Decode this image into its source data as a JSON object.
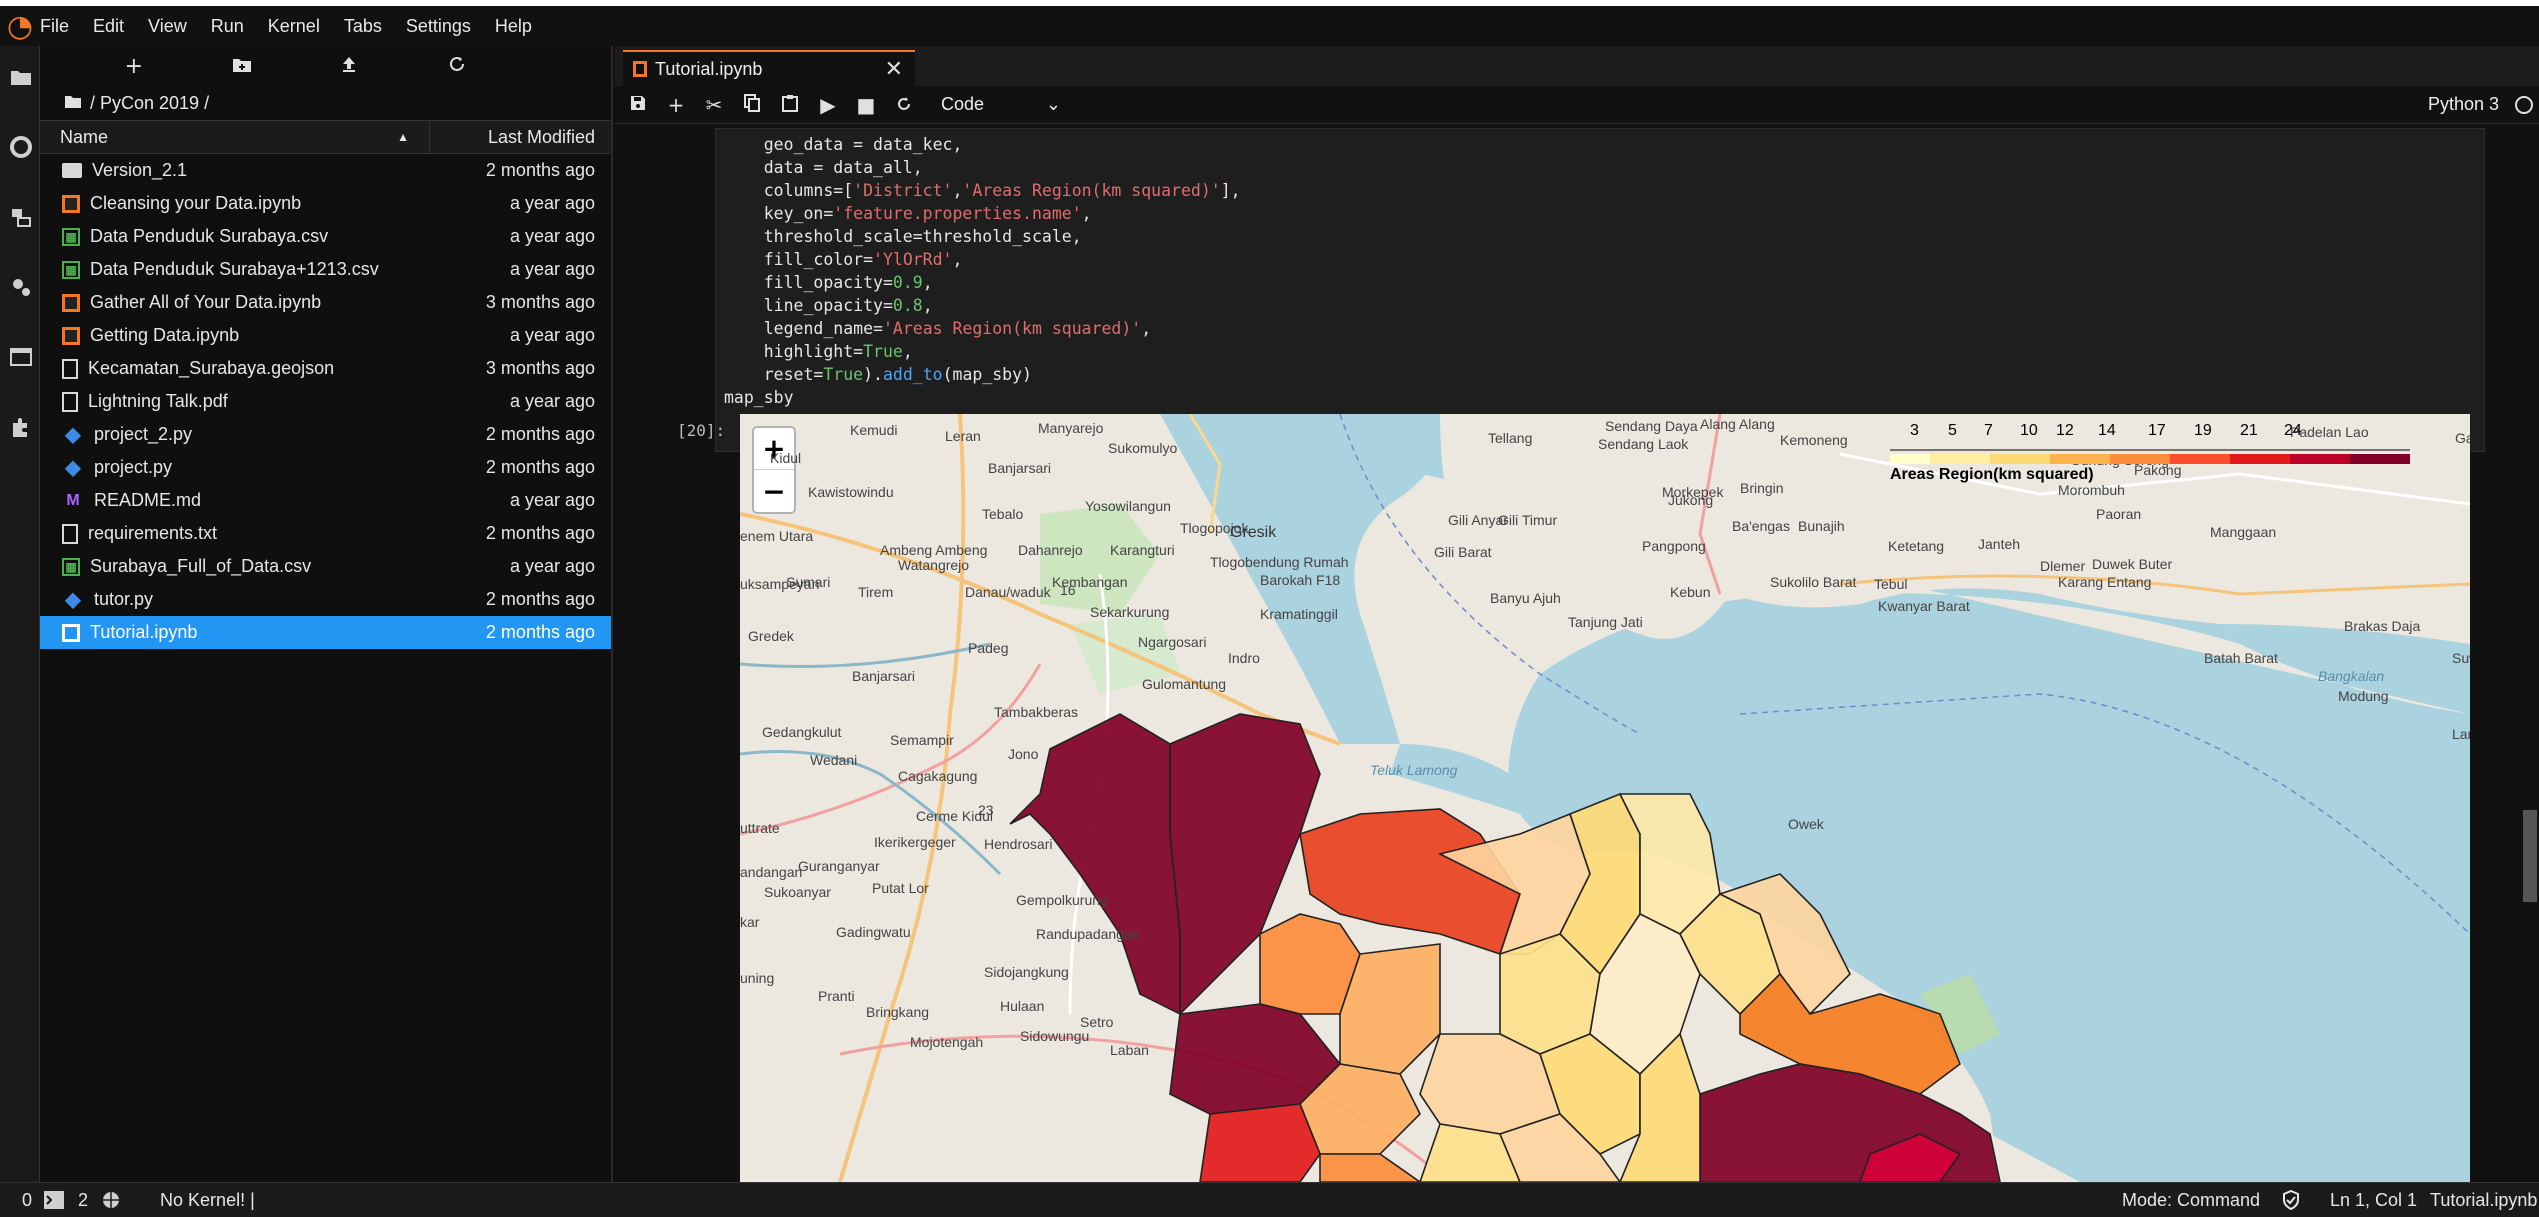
{
  "menu": [
    "File",
    "Edit",
    "View",
    "Run",
    "Kernel",
    "Tabs",
    "Settings",
    "Help"
  ],
  "filebrowser": {
    "crumb": "/ PyCon 2019 /",
    "col_name": "Name",
    "col_modified": "Last Modified",
    "files": [
      {
        "name": "Version_2.1",
        "modified": "2 months ago",
        "type": "folder"
      },
      {
        "name": "Cleansing your Data.ipynb",
        "modified": "a year ago",
        "type": "notebook"
      },
      {
        "name": "Data Penduduk Surabaya.csv",
        "modified": "a year ago",
        "type": "csv"
      },
      {
        "name": "Data Penduduk Surabaya+1213.csv",
        "modified": "a year ago",
        "type": "csv"
      },
      {
        "name": "Gather All of Your Data.ipynb",
        "modified": "3 months ago",
        "type": "notebook"
      },
      {
        "name": "Getting Data.ipynb",
        "modified": "a year ago",
        "type": "notebook"
      },
      {
        "name": "Kecamatan_Surabaya.geojson",
        "modified": "3 months ago",
        "type": "file"
      },
      {
        "name": "Lightning Talk.pdf",
        "modified": "a year ago",
        "type": "file"
      },
      {
        "name": "project_2.py",
        "modified": "2 months ago",
        "type": "python"
      },
      {
        "name": "project.py",
        "modified": "2 months ago",
        "type": "python"
      },
      {
        "name": "README.md",
        "modified": "a year ago",
        "type": "markdown"
      },
      {
        "name": "requirements.txt",
        "modified": "2 months ago",
        "type": "file"
      },
      {
        "name": "Surabaya_Full_of_Data.csv",
        "modified": "a year ago",
        "type": "csv"
      },
      {
        "name": "tutor.py",
        "modified": "2 months ago",
        "type": "python"
      },
      {
        "name": "Tutorial.ipynb",
        "modified": "2 months ago",
        "type": "notebook",
        "selected": true
      }
    ]
  },
  "tab": {
    "title": "Tutorial.ipynb"
  },
  "toolbar": {
    "cell_type": "Code",
    "kernel": "Python 3"
  },
  "code": {
    "lines": [
      "    geo_data = data_kec,",
      "    data = data_all,",
      "    columns=['District','Areas Region(km squared)'],",
      "    key_on='feature.properties.name',",
      "    threshold_scale=threshold_scale,",
      "    fill_color='YlOrRd',",
      "    fill_opacity=0.9,",
      "    line_opacity=0.8,",
      "    legend_name='Areas Region(km squared)',",
      "    highlight=True,",
      "    reset=True).add_to(map_sby)",
      "map_sby"
    ],
    "out_prompt": "[20]:"
  },
  "map": {
    "zoom_in": "+",
    "zoom_out": "−",
    "legend_ticks": [
      "3",
      "5",
      "7",
      "10",
      "12",
      "14",
      "17",
      "19",
      "21",
      "24"
    ],
    "legend_caption": "Areas Region(km squared)",
    "labels": [
      "Kemudi",
      "Leran",
      "Manyarejo",
      "Sukomulyo",
      "Banjarsari",
      "Kawistowindu",
      "Tebalo",
      "Yosowilangun",
      "Tlogopojok",
      "Gresik",
      "Karangturi",
      "Tlogobendung Rumah",
      "Barokah F18",
      "Ambeng Ambeng",
      "Watangrejo",
      "Dahanrejo",
      "Kembangan",
      "Sumari",
      "Tirem",
      "Danau/waduk",
      "Sekarkurung",
      "Kramatinggil",
      "Ngargosari",
      "Indro",
      "Gredek",
      "Banjarsari",
      "Padeg",
      "Gulomantung",
      "Tambakberas",
      "Gedangkulut",
      "Semampir",
      "Wedani",
      "Cagakagung",
      "Jono",
      "Cerme Kidul",
      "Ikerikergeger",
      "Hendrosari",
      "Guranganyar",
      "Sukoanyar",
      "Putat Lor",
      "Gempolkurung",
      "Gadingwatu",
      "Randupadangan",
      "Sidojangkung",
      "Pranti",
      "Bringkang",
      "Hulaan",
      "Setro",
      "Mojotengah",
      "Sidowungu",
      "Laban",
      "Tellang",
      "Sendang Daya",
      "Sendang Laok",
      "Alang Alang",
      "Kemoneng",
      "Gunung Sereng",
      "Pakong",
      "Morombuh",
      "Morkepek",
      "Bringin",
      "Jukong",
      "Gili Anyar",
      "Gili Timur",
      "Gili Barat",
      "Pangpong",
      "Ba'engas",
      "Bunajih",
      "Ketetang",
      "Janteh",
      "Dlemer",
      "Duwek Buter",
      "Paoran",
      "Manggaan",
      "Banyu Ajuh",
      "Kebun",
      "Sukolilo Barat",
      "Tebul",
      "Karang Entang",
      "Tanjung Jati",
      "Kwanyar Barat",
      "Brakas Daja",
      "Batah Barat",
      "Modung",
      "Teluk Lamong",
      "Bangkalan",
      "Owek",
      "Padelan Lao",
      "Kidul",
      "enem Utara",
      "uksampeyan",
      "uttrate",
      "andangan",
      "kar",
      "uning",
      "Ga",
      "Suwa",
      "Lar",
      "16",
      "23"
    ]
  },
  "status": {
    "left_count": "0",
    "terminals": "2",
    "kernel": "No Kernel! |",
    "mode": "Mode: Command",
    "position": "Ln 1, Col 1",
    "file": "Tutorial.ipynb"
  }
}
